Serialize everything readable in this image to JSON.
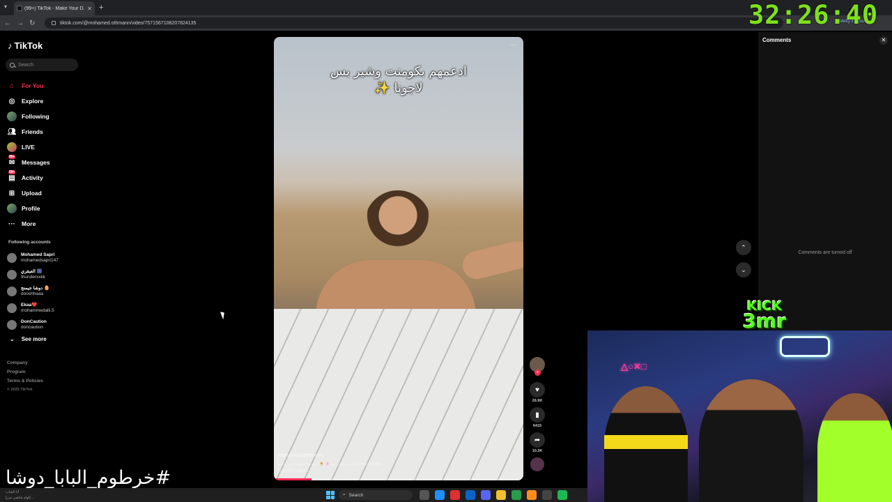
{
  "browser": {
    "tab_title": "(99+) TikTok - Make Your D...",
    "url": "tiktok.com/@mohamed.othmann/video/7571567108207824135",
    "verify_label": "Verify it's you"
  },
  "sidebar": {
    "logo": "TikTok",
    "search_placeholder": "Search",
    "nav": [
      {
        "label": "For You",
        "icon": "home-icon"
      },
      {
        "label": "Explore",
        "icon": "compass-icon"
      },
      {
        "label": "Following",
        "icon": "following-icon"
      },
      {
        "label": "Friends",
        "icon": "friends-icon"
      },
      {
        "label": "LIVE",
        "icon": "live-icon"
      },
      {
        "label": "Messages",
        "icon": "messages-icon",
        "badge": "99+"
      },
      {
        "label": "Activity",
        "icon": "activity-icon",
        "badge": "99+"
      },
      {
        "label": "Upload",
        "icon": "upload-icon"
      },
      {
        "label": "Profile",
        "icon": "profile-icon"
      },
      {
        "label": "More",
        "icon": "more-icon"
      }
    ],
    "following_title": "Following accounts",
    "following": [
      {
        "name": "Mohamed Sapri",
        "handle": "mohamedsapri147"
      },
      {
        "name": "العبقري 🎆",
        "handle": "thunderxxkk"
      },
      {
        "name": "دوشا جيمنج 🥚",
        "handle": "dooshhaaa"
      },
      {
        "name": "Ekaa❤️",
        "handle": "mohammedalli.5"
      },
      {
        "name": "DonCaution",
        "handle": "doncaution"
      }
    ],
    "see_more": "See more",
    "footer": [
      "Company",
      "Program",
      "Terms & Policies"
    ],
    "copyright": "© 2025 TikTok"
  },
  "video": {
    "caption_line1": "ادعمهم بكومنت وشير بس",
    "caption_line2": "لاجونا ✨",
    "author": "mohamed.othmann",
    "description": "ذكريات ليلى دينا 🌸 🌻 #ذهب #لاجونا #ترند_كيرو #foryou #viral",
    "see_translation": "See translation",
    "progress": 0.15
  },
  "actions": {
    "likes": "26.9K",
    "saves": "6415",
    "shares": "10.3K"
  },
  "comments": {
    "title": "Comments",
    "status": "Comments are turned off"
  },
  "stream": {
    "timer": "32:26:40",
    "kick_line1": "KICK",
    "kick_line2": "3mr",
    "tag": "#خرطوم_البابا_دوشا",
    "ticker_line1": "أنا الشاب",
    "ticker_line2": "[إلهام شاهين تبرز ..."
  },
  "taskbar": {
    "search_label": "Search"
  },
  "colors": {
    "accent": "#fe2c55",
    "timer": "#7ee11c",
    "kick": "#53fc18"
  }
}
